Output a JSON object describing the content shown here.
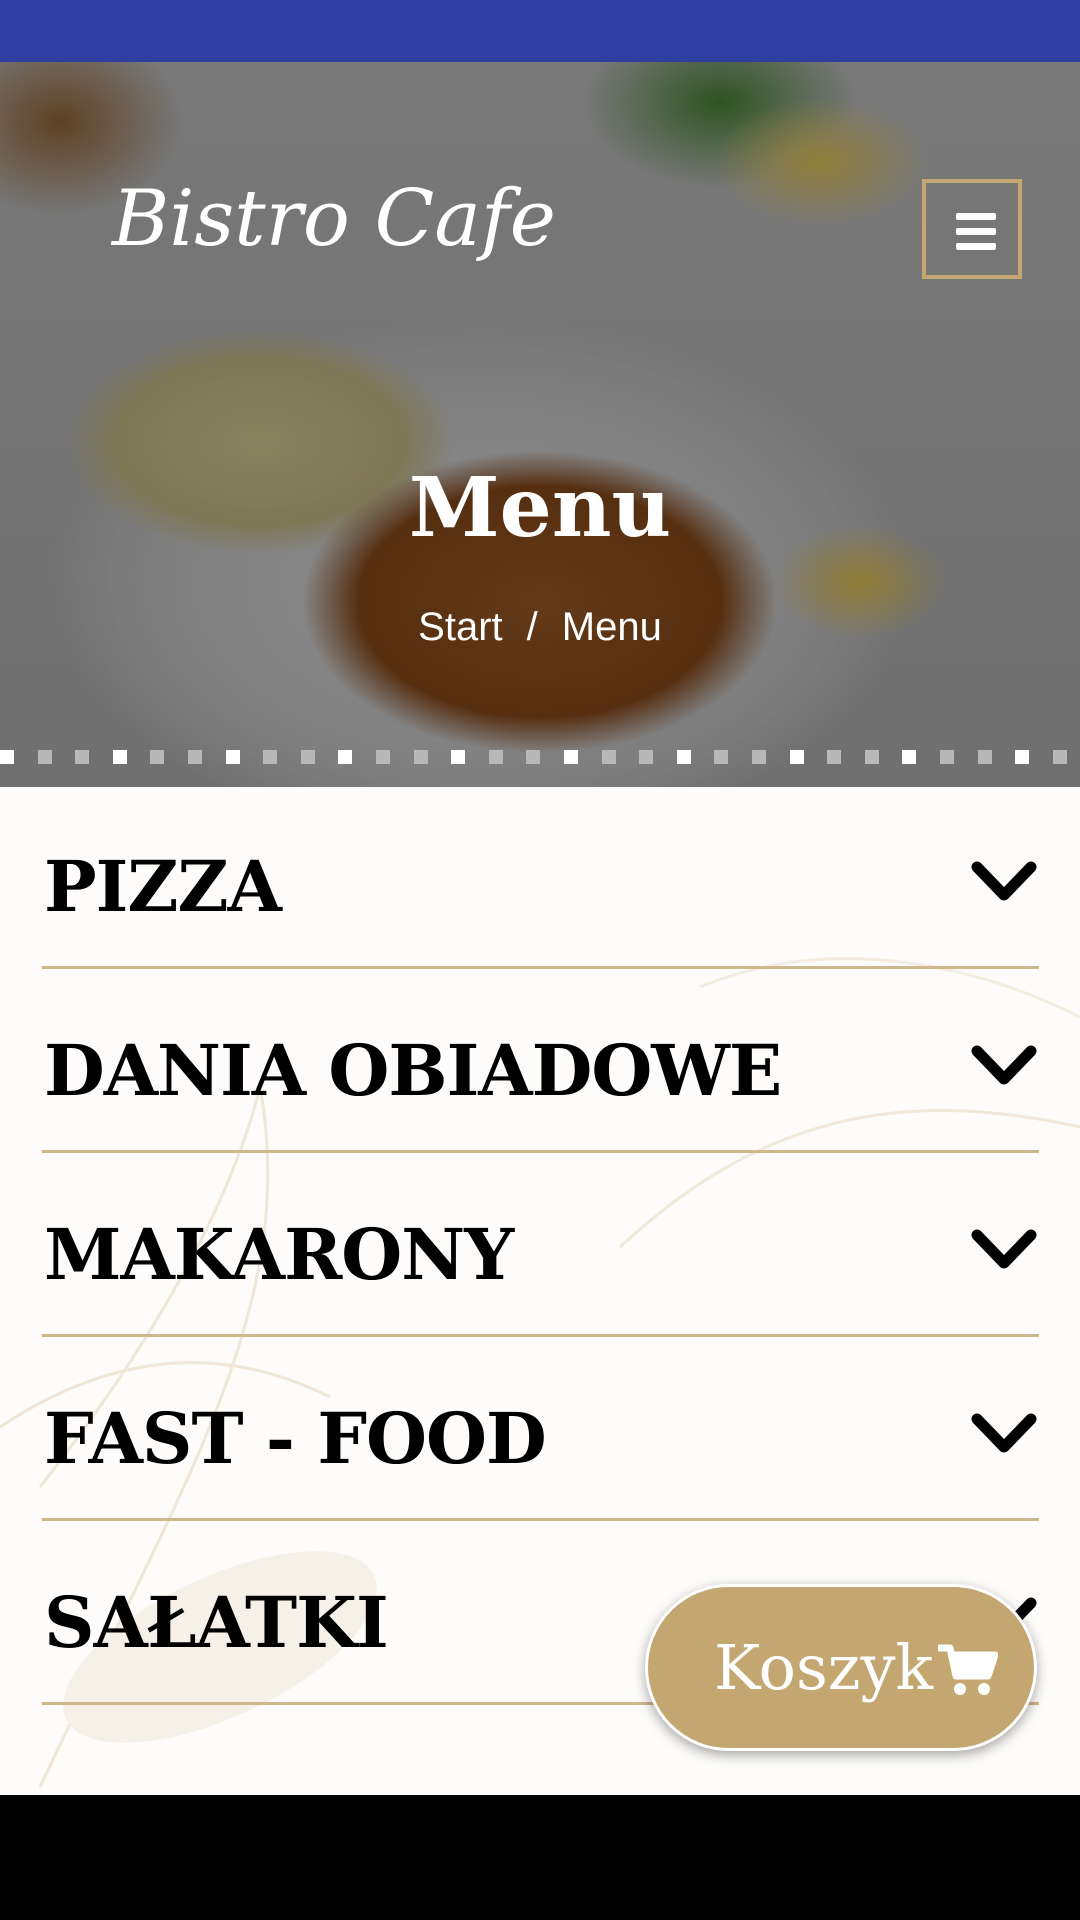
{
  "header": {
    "logo_text": "Bistro Cafe",
    "menu_icon": "hamburger-icon",
    "page_title": "Menu",
    "breadcrumb": {
      "home": "Start",
      "separator": "/",
      "current": "Menu"
    }
  },
  "menu": {
    "categories": [
      {
        "label": "PIZZA",
        "icon": "chevron-down-icon"
      },
      {
        "label": "DANIA OBIADOWE",
        "icon": "chevron-down-icon"
      },
      {
        "label": "MAKARONY",
        "icon": "chevron-down-icon"
      },
      {
        "label": "FAST - FOOD",
        "icon": "chevron-down-icon"
      },
      {
        "label": "SAŁATKI",
        "icon": "chevron-down-icon"
      }
    ]
  },
  "cart": {
    "label": "Koszyk",
    "icon": "shopping-cart-icon"
  },
  "colors": {
    "status_bar": "#2e3fa1",
    "accent_gold": "#c4a671",
    "divider": "#cfb98c",
    "text_dark": "#000000",
    "text_light": "#ffffff"
  }
}
